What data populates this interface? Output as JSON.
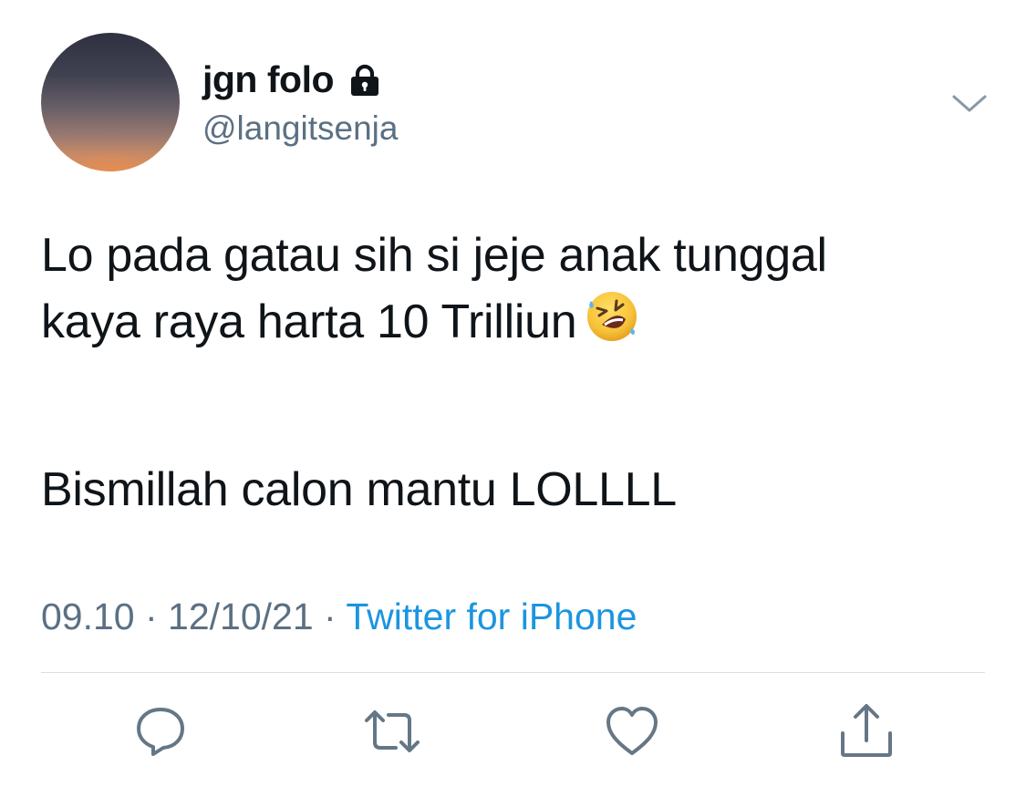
{
  "author": {
    "display_name": "jgn folo",
    "handle": "@langitsenja",
    "protected_icon": "lock-icon"
  },
  "tweet": {
    "line1": "Lo pada gatau sih si jeje anak tunggal",
    "line2": "kaya raya harta 10 Trilliun",
    "emoji": "rolling-on-the-floor-laughing",
    "line3": "Bismillah calon mantu LOLLLL"
  },
  "meta": {
    "time": "09.10",
    "separator1": " · ",
    "date": "12/10/21",
    "separator2": " · ",
    "source": "Twitter for iPhone"
  },
  "actions": {
    "reply_icon": "reply-icon",
    "retweet_icon": "retweet-icon",
    "like_icon": "heart-icon",
    "share_icon": "share-icon"
  },
  "colors": {
    "text": "#0f1419",
    "secondary": "#5b7083",
    "link": "#1b95e0",
    "icon": "#657786",
    "divider": "#d9dee3"
  }
}
